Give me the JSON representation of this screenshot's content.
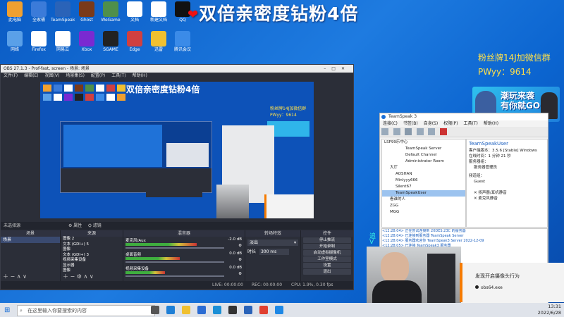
{
  "overlay": {
    "title": "双倍亲密度钻粉4倍",
    "promo_line1": "粉丝牌14J加微信群",
    "promo_line2": "PWyy：9614",
    "banner_text1": "潮玩来袭",
    "banner_text2": "有你就GO",
    "side_cyan1": "追",
    "side_cyan2": "V"
  },
  "desktop_icons": [
    {
      "label": "此电脑",
      "color": "#f0a030"
    },
    {
      "label": "全家桶",
      "color": "#3b7bd9"
    },
    {
      "label": "TeamSpeak",
      "color": "#2a63b8"
    },
    {
      "label": "Ghost",
      "color": "#7a3a1a"
    },
    {
      "label": "WeGame",
      "color": "#4f8f4a"
    },
    {
      "label": "文档",
      "color": "#ffffff"
    },
    {
      "label": "新建文档",
      "color": "#ffffff"
    },
    {
      "label": "QQ",
      "color": "#111111"
    },
    {
      "label": "网络",
      "color": "#5aa0e8"
    },
    {
      "label": "Firefox",
      "color": "#ffffff"
    },
    {
      "label": "网易云",
      "color": "#ffffff"
    },
    {
      "label": "Xbox",
      "color": "#7a2ad1"
    },
    {
      "label": "SGAME",
      "color": "#222222"
    },
    {
      "label": "Edge",
      "color": "#d04040"
    },
    {
      "label": "迅雷",
      "color": "#f0c030"
    },
    {
      "label": "腾讯会议",
      "color": "#3b8be8"
    }
  ],
  "obs": {
    "window_title": "OBS 27.1.3 - Prof-fast, screen - 场景: 场景",
    "menu": [
      "文件(F)",
      "编辑(E)",
      "视图(V)",
      "场景集(S)",
      "配置(P)",
      "工具(T)",
      "帮助(H)"
    ],
    "no_source": "未选择源",
    "props_btn": "属性",
    "filters_btn": "滤镜",
    "docks": {
      "scenes": "场景",
      "sources": "来源",
      "mixer": "混音器",
      "transitions": "转场特效",
      "controls": "控件"
    },
    "scenes": [
      "场景"
    ],
    "sources": [
      "图像 2",
      "文本 (GDI+) 5",
      "图像",
      "文本 (GDI+) 3",
      "视频采集设备",
      "显示器",
      "图像"
    ],
    "mixer": [
      {
        "name": "麦克风/Aux",
        "db": "-2.0 dB",
        "level": 0.72
      },
      {
        "name": "桌面音频",
        "db": "0.0 dB",
        "level": 0.55
      },
      {
        "name": "视频采集设备",
        "db": "0.0 dB",
        "level": 0.4
      }
    ],
    "transition": {
      "type": "淡出",
      "duration_label": "时长",
      "duration": "300 ms"
    },
    "controls": [
      "停止推流",
      "开始录制",
      "启动虚拟摄像机",
      "工作室模式",
      "设置",
      "退出"
    ],
    "status": {
      "live": "LIVE: 00:00:00",
      "rec": "REC: 00:00:00",
      "cpu": "CPU: 1.9%, 0.30 fps"
    }
  },
  "teamspeak": {
    "window_title": "TeamSpeak 3",
    "menu": [
      "连接(C)",
      "书签(B)",
      "自身(S)",
      "权限(P)",
      "工具(T)",
      "帮助(H)"
    ],
    "tree": [
      "LSP99乐中心",
      "TeamSpeak Server",
      "Default Channel",
      "Administrator Room",
      "大厅",
      "AOSHAN",
      "Minlyyy666",
      "Silent67",
      "TeamSpeakUser",
      "看谁的人",
      "ZGG",
      "MGG"
    ],
    "info": {
      "user": "TeamSpeakUser",
      "version_label": "客户端版本：",
      "version": "3.5.6 [Stable] Windows",
      "online_label": "在线时间：",
      "online": "1 分钟 21 秒",
      "groups_label": "服务器组：",
      "group": "服务器管理员",
      "channel_group_label": "频道组：",
      "channel_group": "Guest",
      "mic": "麦克风静音",
      "speaker": "扬声器/耳机静音"
    },
    "chat": [
      "<12:28:04> 正在尝试连接到 20DES.23C 的服务器",
      "<12:28:04> 已连接到服务器 TeamSpeak Server",
      "<12:28:04> 服务器欢迎你 TeamSpeak3 Server 2022-12-09",
      "<12:28:05> 已连接 TeamSpeak3 服务器"
    ]
  },
  "notification": {
    "title": "发现开启摄像头行为",
    "app": "obs64.exe"
  },
  "taskbar": {
    "search_placeholder": "在这里输入你要搜索的内容",
    "time": "13:31",
    "date": "2022/6/28",
    "icons": [
      "task-view",
      "edge",
      "file-explorer",
      "store",
      "mail",
      "obs",
      "teamspeak",
      "chrome",
      "qq"
    ]
  }
}
